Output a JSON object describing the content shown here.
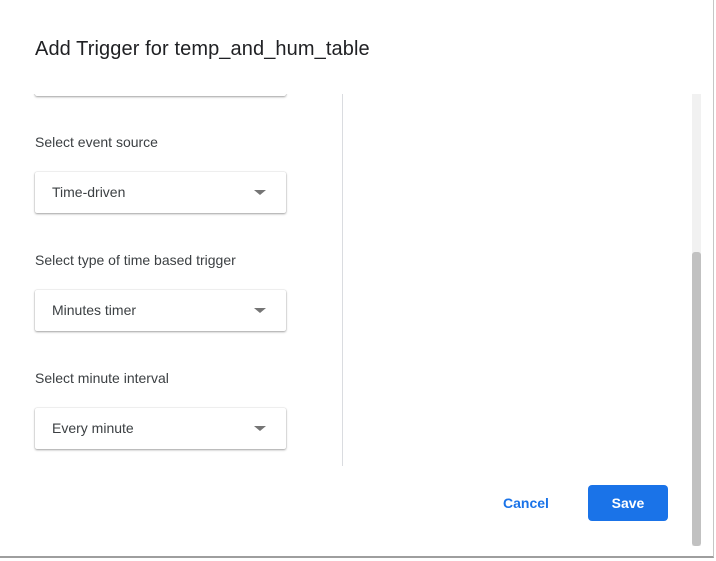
{
  "dialog": {
    "title": "Add Trigger for temp_and_hum_table"
  },
  "fields": [
    {
      "label": "Select event source",
      "value": "Time-driven"
    },
    {
      "label": "Select type of time based trigger",
      "value": "Minutes timer"
    },
    {
      "label": "Select minute interval",
      "value": "Every minute"
    }
  ],
  "actions": {
    "cancel_label": "Cancel",
    "save_label": "Save"
  },
  "icons": {
    "dropdown": "chevron-down-icon"
  },
  "colors": {
    "accent": "#1a73e8",
    "text": "#3c4043",
    "title": "#202124"
  }
}
